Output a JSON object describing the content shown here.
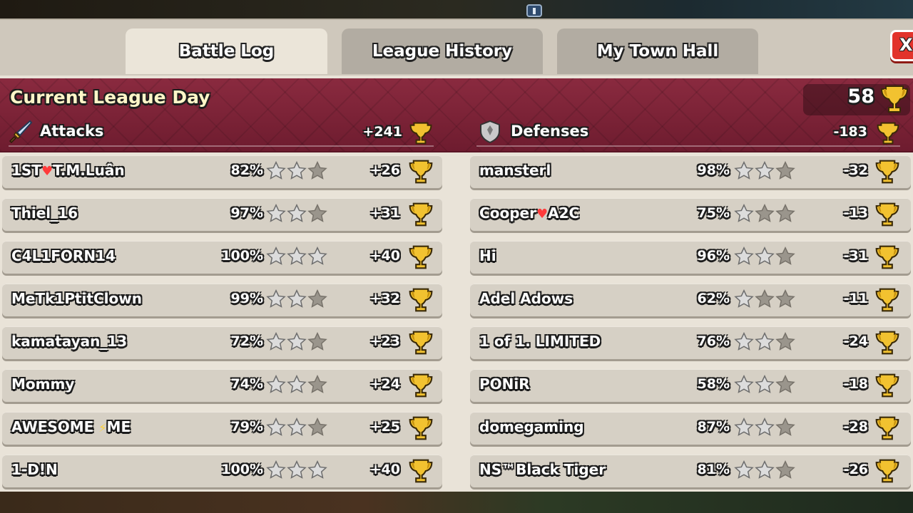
{
  "tabs": [
    {
      "label": "Battle Log",
      "active": true
    },
    {
      "label": "League History",
      "active": false
    },
    {
      "label": "My Town Hall",
      "active": false
    }
  ],
  "close_label": "X",
  "league": {
    "title": "Current League Day",
    "total_trophies": "58"
  },
  "attacks": {
    "label": "Attacks",
    "total": "+241",
    "icon": "sword-icon",
    "rows": [
      {
        "name": "1ST♥T.M.Luân",
        "percent": "82%",
        "stars": 2,
        "trophies": "+26"
      },
      {
        "name": "Thiel_16",
        "percent": "97%",
        "stars": 2,
        "trophies": "+31"
      },
      {
        "name": "C4L1FORN14",
        "percent": "100%",
        "stars": 3,
        "trophies": "+40"
      },
      {
        "name": "MeTk1PtitClown",
        "percent": "99%",
        "stars": 2,
        "trophies": "+32"
      },
      {
        "name": "kamatayan_13",
        "percent": "72%",
        "stars": 2,
        "trophies": "+23"
      },
      {
        "name": "Mommy",
        "percent": "74%",
        "stars": 2,
        "trophies": "+24"
      },
      {
        "name": "AWESOME ⚡ME",
        "percent": "79%",
        "stars": 2,
        "trophies": "+25"
      },
      {
        "name": "1-D!N",
        "percent": "100%",
        "stars": 3,
        "trophies": "+40"
      }
    ]
  },
  "defenses": {
    "label": "Defenses",
    "total": "-183",
    "icon": "shield-icon",
    "rows": [
      {
        "name": "mansterl",
        "percent": "98%",
        "stars": 2,
        "trophies": "-32"
      },
      {
        "name": "Cooper♥A2C",
        "percent": "75%",
        "stars": 1,
        "trophies": "-13"
      },
      {
        "name": "Hi",
        "percent": "96%",
        "stars": 2,
        "trophies": "-31"
      },
      {
        "name": "Adel Adows",
        "percent": "62%",
        "stars": 1,
        "trophies": "-11"
      },
      {
        "name": "1 of 1. LIMITED",
        "percent": "76%",
        "stars": 2,
        "trophies": "-24"
      },
      {
        "name": "PONiR",
        "percent": "58%",
        "stars": 2,
        "trophies": "-18"
      },
      {
        "name": "domegaming",
        "percent": "87%",
        "stars": 2,
        "trophies": "-28"
      },
      {
        "name": "NS™Black Tiger",
        "percent": "81%",
        "stars": 2,
        "trophies": "-26"
      }
    ]
  },
  "colors": {
    "band": "#7b2035",
    "panel": "#e9e3d8",
    "row": "#d6d0c5",
    "star_filled": "#dcdcdc",
    "star_empty": "#9a958c",
    "trophy_gold": "#f2c230"
  }
}
